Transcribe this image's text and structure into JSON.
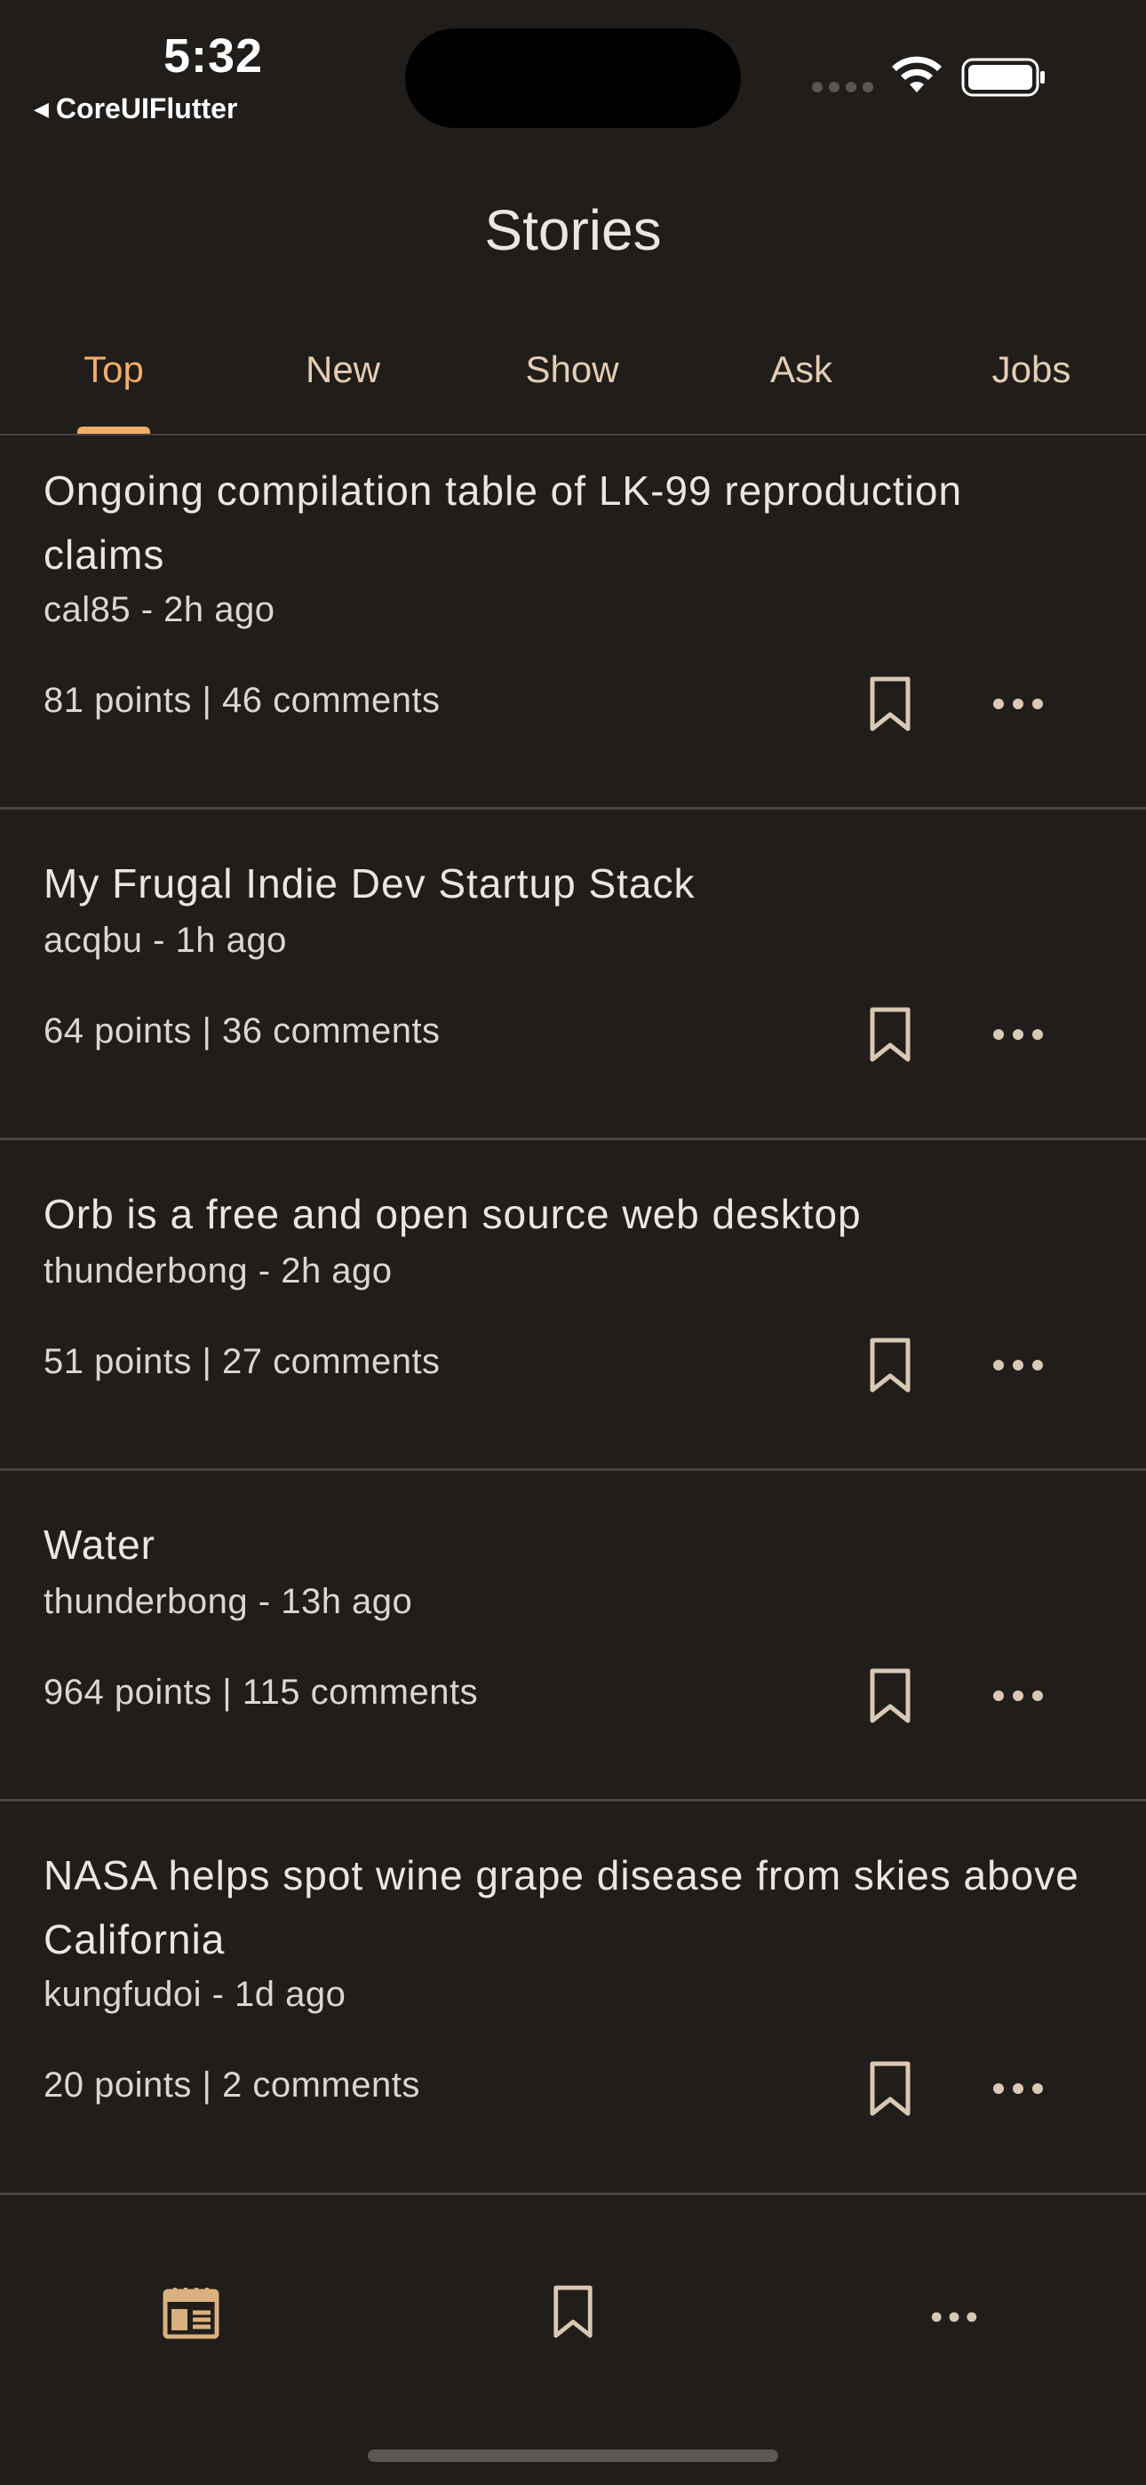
{
  "status_bar": {
    "time": "5:32",
    "back_app": "CoreUIFlutter"
  },
  "header": {
    "title": "Stories"
  },
  "tabs": [
    {
      "label": "Top",
      "active": true
    },
    {
      "label": "New",
      "active": false
    },
    {
      "label": "Show",
      "active": false
    },
    {
      "label": "Ask",
      "active": false
    },
    {
      "label": "Jobs",
      "active": false
    }
  ],
  "stories": [
    {
      "title": "Ongoing compilation table of LK-99 reproduction claims",
      "meta": "cal85 - 2h ago",
      "stats": "81 points | 46 comments"
    },
    {
      "title": "My Frugal Indie Dev Startup Stack",
      "meta": "acqbu - 1h ago",
      "stats": "64 points | 36 comments"
    },
    {
      "title": "Orb is a free and open source web desktop",
      "meta": "thunderbong - 2h ago",
      "stats": "51 points | 27 comments"
    },
    {
      "title": "Water",
      "meta": "thunderbong - 13h ago",
      "stats": "964 points | 115 comments"
    },
    {
      "title": "NASA helps spot wine grape disease from skies above California",
      "meta": "kungfudoi - 1d ago",
      "stats": "20 points | 2 comments"
    }
  ],
  "bottom_nav": [
    {
      "icon": "newspaper-icon",
      "active": true
    },
    {
      "icon": "bookmark-icon",
      "active": false
    },
    {
      "icon": "more-icon",
      "active": false
    }
  ],
  "colors": {
    "background": "#201d1a",
    "accent": "#f2ad69",
    "text": "#ece6df",
    "inactive_tab": "#e3cdb4",
    "icon": "#d9c8b4",
    "divider": "#4a443e"
  }
}
